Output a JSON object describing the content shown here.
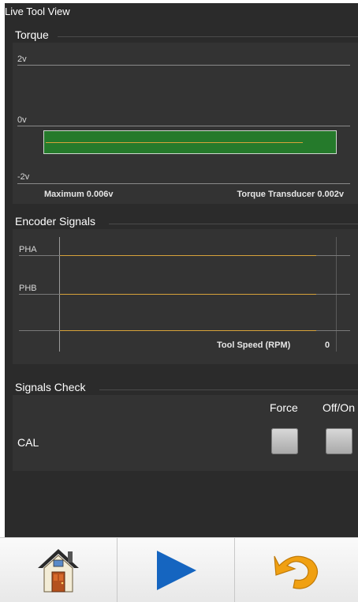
{
  "window": {
    "title": "Live Tool View"
  },
  "torque": {
    "title": "Torque",
    "scale_top": "2v",
    "scale_mid": "0v",
    "scale_bottom": "-2v",
    "maximum": "Maximum 0.006v",
    "transducer": "Torque Transducer 0.002v"
  },
  "encoder": {
    "title": "Encoder Signals",
    "pha": "PHA",
    "phb": "PHB",
    "speed_label": "Tool Speed (RPM)",
    "speed_value": "0"
  },
  "signals_check": {
    "title": "Signals Check",
    "col_force": "Force",
    "col_offon": "Off/On",
    "row_cal": "CAL"
  },
  "bottom_bar": {
    "home_icon": "home-icon",
    "play_icon": "play-icon",
    "undo_icon": "undo-icon"
  },
  "colors": {
    "background": "#2b2b2b",
    "torque_bar": "#257a2b",
    "signal_trace": "#d6a23a",
    "play_blue": "#1565c0"
  }
}
